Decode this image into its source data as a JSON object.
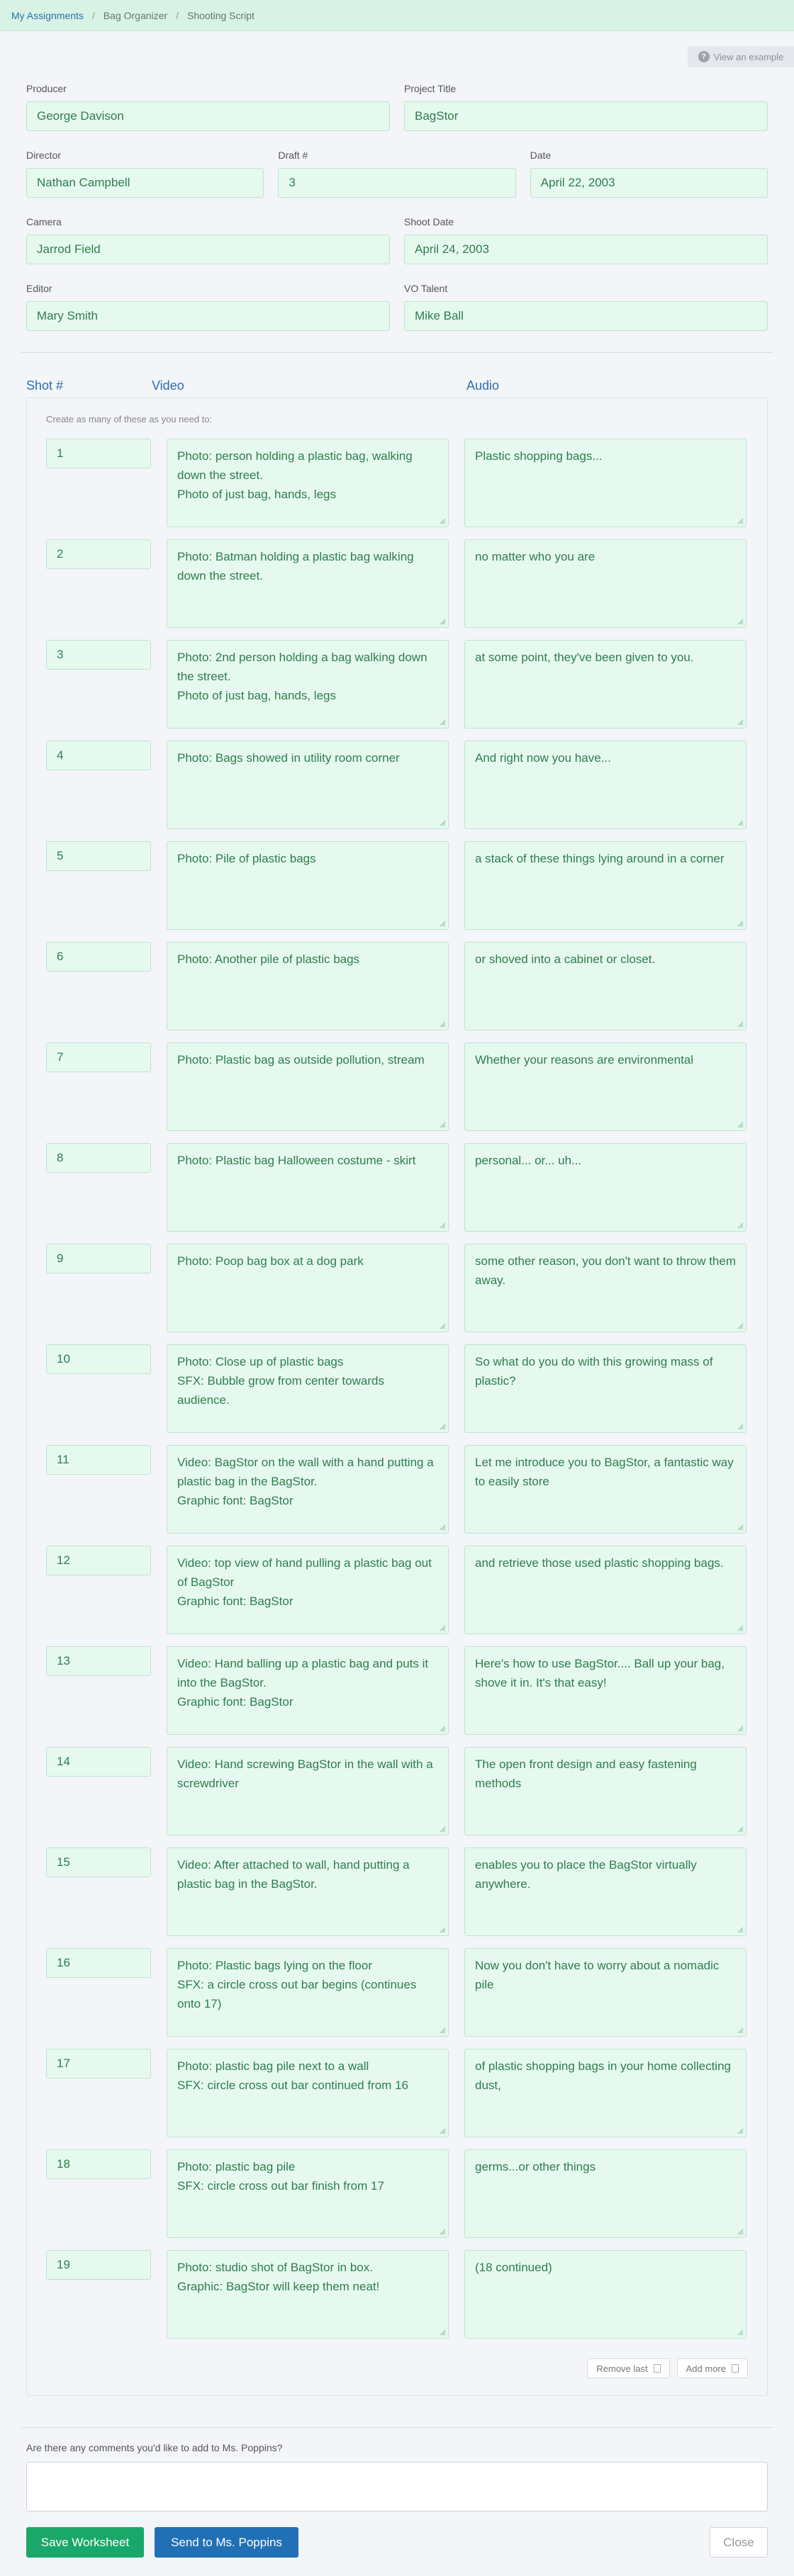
{
  "breadcrumb": {
    "items": [
      "My Assignments",
      "Bag Organizer",
      "Shooting Script"
    ]
  },
  "example_link": "View an example",
  "fields": {
    "producer": {
      "label": "Producer",
      "value": "George Davison"
    },
    "project_title": {
      "label": "Project Title",
      "value": "BagStor"
    },
    "director": {
      "label": "Director",
      "value": "Nathan Campbell"
    },
    "draft": {
      "label": "Draft #",
      "value": "3"
    },
    "date": {
      "label": "Date",
      "value": "April 22, 2003"
    },
    "camera": {
      "label": "Camera",
      "value": "Jarrod Field"
    },
    "shoot_date": {
      "label": "Shoot Date",
      "value": "April 24, 2003"
    },
    "editor": {
      "label": "Editor",
      "value": "Mary Smith"
    },
    "vo_talent": {
      "label": "VO Talent",
      "value": "Mike Ball"
    }
  },
  "script": {
    "columns": [
      "Shot #",
      "Video",
      "Audio"
    ],
    "note": "Create as many of these as you need to:",
    "shots": [
      {
        "num": "1",
        "video": "Photo: person holding a plastic bag, walking down the street.\nPhoto of just bag, hands, legs",
        "audio": "Plastic shopping bags..."
      },
      {
        "num": "2",
        "video": "Photo: Batman holding a plastic bag walking down the street.",
        "audio": "no matter who you are"
      },
      {
        "num": "3",
        "video": "Photo: 2nd person holding a bag walking down the street.\nPhoto of just bag, hands, legs",
        "audio": "at some point, they've been given to you."
      },
      {
        "num": "4",
        "video": "Photo: Bags showed in utility room corner",
        "audio": "And right now you have..."
      },
      {
        "num": "5",
        "video": "Photo: Pile of plastic bags",
        "audio": "a stack of these things lying around in a corner"
      },
      {
        "num": "6",
        "video": "Photo: Another pile of plastic bags",
        "audio": "or shoved into a cabinet or closet."
      },
      {
        "num": "7",
        "video": "Photo: Plastic bag as outside pollution, stream",
        "audio": "Whether your reasons are environmental"
      },
      {
        "num": "8",
        "video": "Photo: Plastic bag Halloween costume - skirt",
        "audio": "personal... or... uh..."
      },
      {
        "num": "9",
        "video": "Photo: Poop bag box at a dog park",
        "audio": "some other reason, you don't want to throw them away."
      },
      {
        "num": "10",
        "video": "Photo: Close up of plastic bags\nSFX: Bubble grow from center towards audience.",
        "audio": "So what do you do with this growing mass of plastic?"
      },
      {
        "num": "11",
        "video": "Video: BagStor on the wall with a hand putting a plastic bag in the BagStor.\nGraphic font: BagStor",
        "audio": "Let me introduce you to BagStor, a fantastic way to easily store"
      },
      {
        "num": "12",
        "video": "Video: top view of hand pulling a plastic bag out of BagStor\nGraphic font: BagStor",
        "audio": "and retrieve those used plastic shopping bags."
      },
      {
        "num": "13",
        "video": "Video: Hand balling up a plastic bag and puts it into the BagStor.\nGraphic font: BagStor",
        "audio": "Here's how to use BagStor.... Ball up your bag, shove it in. It's that easy!"
      },
      {
        "num": "14",
        "video": "Video: Hand screwing BagStor in the wall with a screwdriver",
        "audio": "The open front design and easy fastening methods"
      },
      {
        "num": "15",
        "video": "Video: After attached to wall, hand putting a plastic bag in the BagStor.",
        "audio": "enables you to place the BagStor virtually anywhere."
      },
      {
        "num": "16",
        "video": "Photo: Plastic bags lying on the floor\nSFX: a circle cross out bar begins (continues onto 17)",
        "audio": "Now you don't have to worry about a nomadic pile"
      },
      {
        "num": "17",
        "video": "Photo: plastic bag pile next to a wall\nSFX: circle cross out bar continued from 16",
        "audio": "of plastic shopping bags in your home collecting dust,"
      },
      {
        "num": "18",
        "video": "Photo: plastic bag pile\nSFX: circle cross out bar finish from 17",
        "audio": "germs...or other things"
      },
      {
        "num": "19",
        "video": "Photo: studio shot of BagStor in box.\nGraphic: BagStor will keep them neat!",
        "audio": "(18 continued)"
      }
    ],
    "remove_last": "Remove last",
    "add_more": "Add more"
  },
  "comments": {
    "label": "Are there any comments you'd like to add to Ms. Poppins?",
    "value": ""
  },
  "buttons": {
    "save": "Save Worksheet",
    "send": "Send to Ms. Poppins",
    "close": "Close"
  }
}
